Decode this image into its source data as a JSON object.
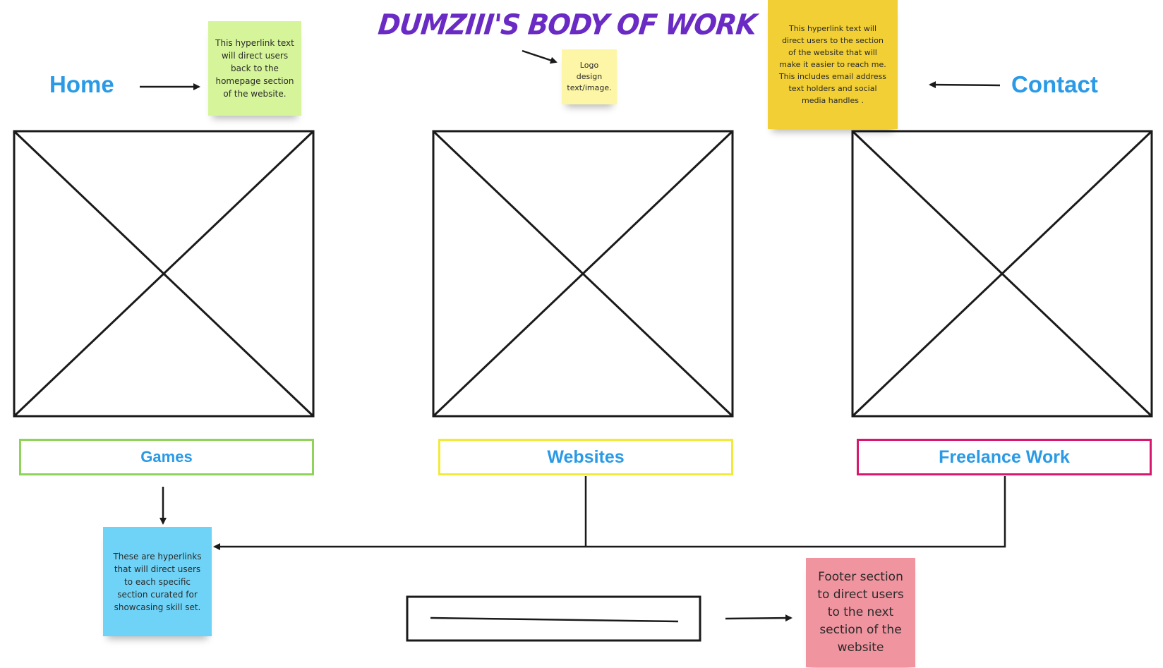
{
  "title": "DUMZIII'S BODY OF WORK",
  "nav": {
    "home": "Home",
    "contact": "Contact"
  },
  "sections": {
    "games": "Games",
    "websites": "Websites",
    "freelance": "Freelance Work"
  },
  "notes": {
    "home": "This hyperlink text will direct users back to the homepage section of the website.",
    "logo": "Logo design text/image.",
    "contact": "This hyperlink text will direct users to the section of the website that will make it easier to reach me. This includes email address text holders and social media handles .",
    "hyperlinks": "These are hyperlinks that will direct users to each specific section curated for showcasing skill set.",
    "footer": "Footer section to direct users to the next section of the website"
  },
  "colors": {
    "title": "#6a2bc4",
    "link": "#2a9ae6",
    "note_home": "#d6f59a",
    "note_logo": "#fdf6a6",
    "note_contact": "#f1cf35",
    "note_hyperlinks": "#6fd3f7",
    "note_footer": "#f0949f",
    "games_border": "#8fd35a",
    "websites_border": "#f2ea3a",
    "freelance_border": "#d7186e"
  }
}
